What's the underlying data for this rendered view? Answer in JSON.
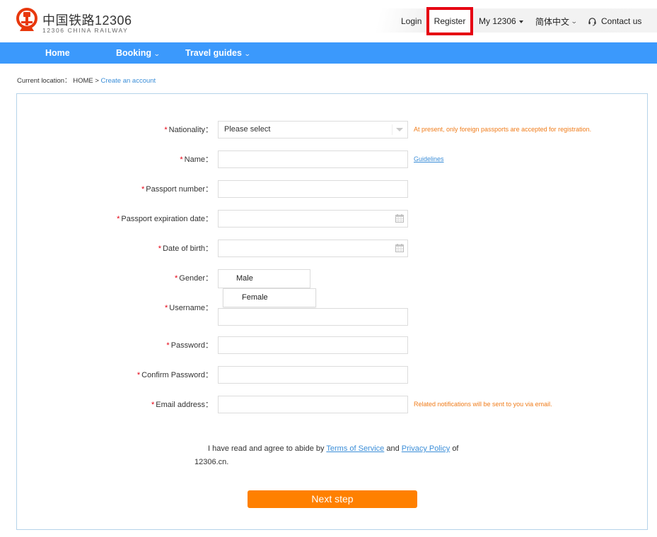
{
  "brand": {
    "name_cn": "中国铁路12306",
    "name_en": "12306 CHINA RAILWAY",
    "primary_color": "#3b99fc",
    "accent_color": "#ff8000",
    "highlight_color": "#e60012"
  },
  "top_nav": {
    "login": "Login",
    "register": "Register",
    "my_12306": "My 12306",
    "language": "简体中文",
    "contact": "Contact us"
  },
  "main_nav": {
    "home": "Home",
    "booking": "Booking",
    "travel_guides": "Travel guides"
  },
  "breadcrumb": {
    "prefix": "Current location：",
    "home": "HOME",
    "separator": ">",
    "current": "Create an account"
  },
  "form": {
    "required_mark": "*",
    "nationality": {
      "label": "Nationality：",
      "value": "Please select",
      "hint": "At present, only foreign passports are accepted for registration."
    },
    "name": {
      "label": "Name：",
      "value": "",
      "guidelines_link": "Guidelines"
    },
    "passport_number": {
      "label": "Passport number：",
      "value": ""
    },
    "passport_expiration": {
      "label": "Passport expiration date：",
      "value": ""
    },
    "date_of_birth": {
      "label": "Date of birth：",
      "value": ""
    },
    "gender": {
      "label": "Gender：",
      "options": [
        "Male",
        "Female"
      ]
    },
    "username": {
      "label": "Username：",
      "value": ""
    },
    "password": {
      "label": "Password：",
      "value": ""
    },
    "confirm_password": {
      "label": "Confirm Password：",
      "value": ""
    },
    "email": {
      "label": "Email address：",
      "value": "",
      "hint": "Related notifications will be sent to you via email."
    }
  },
  "agreement": {
    "text_before": "I have read and agree to abide by",
    "terms": "Terms of Service",
    "and": "and",
    "privacy": "Privacy Policy",
    "of": "of",
    "site": "12306.cn."
  },
  "next_button": "Next step"
}
